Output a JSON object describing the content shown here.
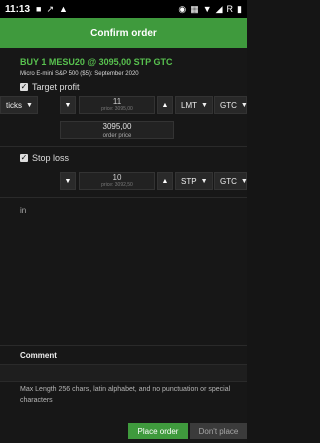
{
  "status_bar": {
    "time": "11:13",
    "icons_left": [
      "■",
      "↗",
      "▲"
    ],
    "icons_right": [
      "◉",
      "▦",
      "▼",
      "◢",
      "▮"
    ],
    "rail": "R"
  },
  "header": {
    "title": "Confirm order"
  },
  "order": {
    "summary": "BUY 1 MESU20 @ 3095,00 STP GTC",
    "contract": "Micro E-mini S&P 500 ($5): September 2020"
  },
  "target_profit": {
    "label": "Target profit",
    "unit_select": "ticks",
    "value": "11",
    "price_hint": "price: 3095,00",
    "order_price_value": "3095,00",
    "order_price_label": "order price",
    "type": "LMT",
    "tif": "GTC"
  },
  "stop_loss": {
    "label": "Stop loss",
    "value": "10",
    "price_hint": "price: 3092,50",
    "type": "STP",
    "tif": "GTC"
  },
  "in_label": "in",
  "comment": {
    "heading": "Comment",
    "hint": "Max Length 256 chars, latin alphabet, and no punctuation or special characters"
  },
  "buttons": {
    "place": "Place order",
    "dont": "Don't place"
  },
  "colors": {
    "accent": "#3f9a3d",
    "title_green": "#58c14f",
    "background": "#171717"
  }
}
